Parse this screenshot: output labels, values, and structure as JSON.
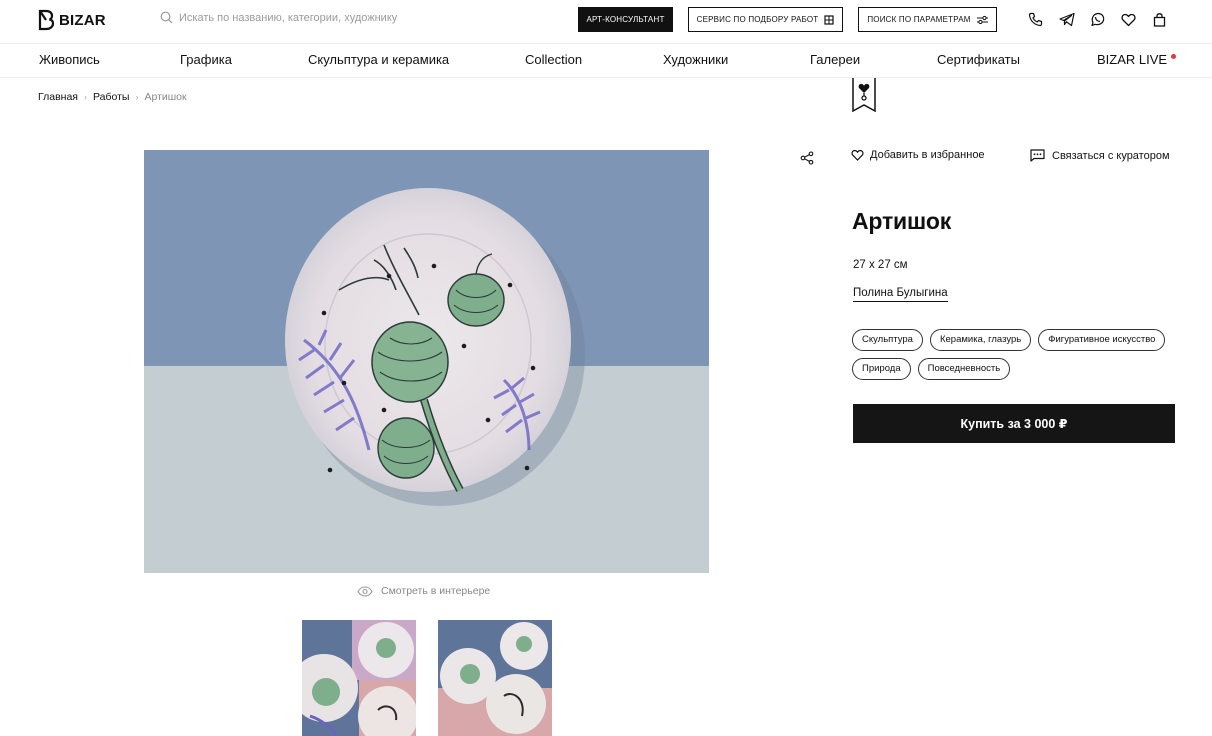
{
  "header": {
    "logo_text": "BIZAR",
    "search_placeholder": "Искать по названию, категории, художнику",
    "btn_consultant": "АРТ-КОНСУЛЬТАНТ",
    "btn_selection": "СЕРВИС ПО ПОДБОРУ РАБОТ",
    "btn_params": "ПОИСК ПО ПАРАМЕТРАМ",
    "icons": [
      "phone-icon",
      "telegram-icon",
      "whatsapp-icon",
      "heart-icon",
      "bag-icon"
    ]
  },
  "nav": {
    "items": [
      "Живопись",
      "Графика",
      "Скульптура и керамика",
      "Collection",
      "Художники",
      "Галереи",
      "Сертификаты",
      "BIZAR LIVE"
    ]
  },
  "breadcrumb": {
    "items": [
      "Главная",
      "Работы",
      "Артишок"
    ]
  },
  "gallery": {
    "interior_label": "Смотреть в интерьере"
  },
  "product": {
    "add_favorite": "Добавить в избранное",
    "contact_curator": "Связаться с куратором",
    "title": "Артишок",
    "size": "27 x 27 см",
    "artist": "Полина Булыгина",
    "tags": [
      "Скульптура",
      "Керамика, глазурь",
      "Фигуративное искусство",
      "Природа",
      "Повседневность"
    ],
    "buy_label": "Купить за 3 000 ₽"
  },
  "colors": {
    "accent": "#151515",
    "live_dot": "#e53935",
    "wall_blue": "#7f95b6",
    "table_grey": "#c4cdd1"
  }
}
